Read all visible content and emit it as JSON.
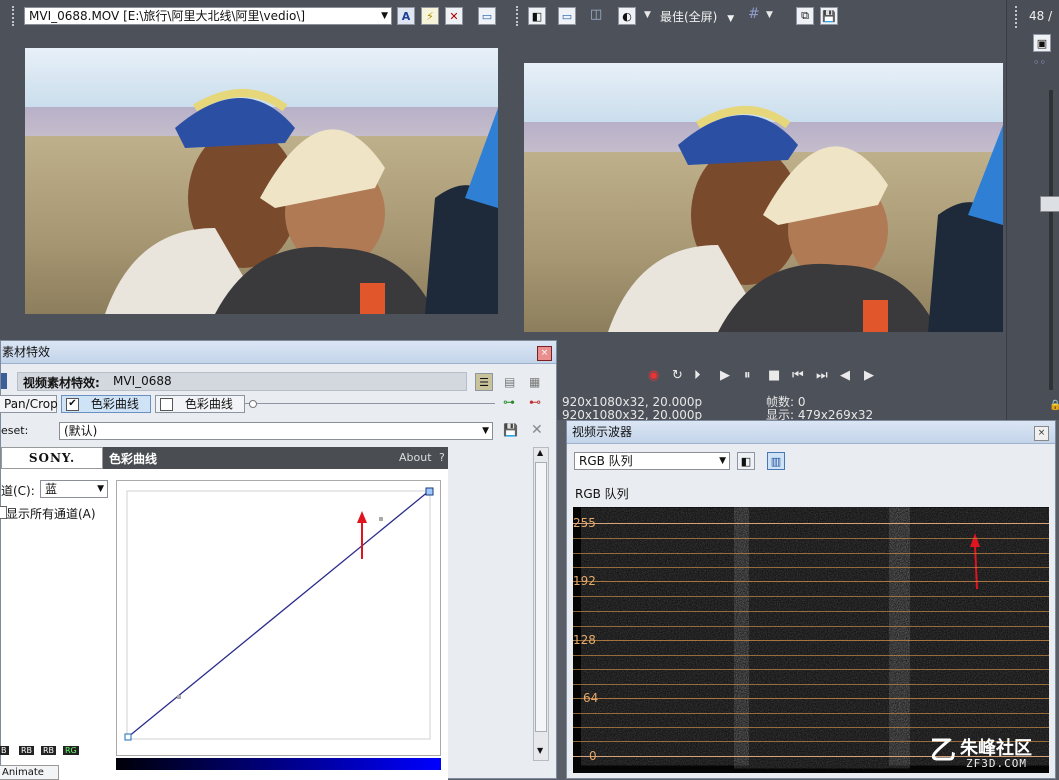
{
  "source_viewer": {
    "clip_dropdown": "MVI_0688.MOV     [E:\\旅行\\阿里大北线\\阿里\\vedio\\]"
  },
  "preview": {
    "quality_label": "最佳(全屏)",
    "info": {
      "project_line": "920x1080x32, 20.000p",
      "preview_line": "920x1080x32, 20.000p",
      "frame_label": "帧数:",
      "frame_value": "0",
      "display_line": "显示: 479x269x32"
    }
  },
  "right_strip": {
    "counter": "48 /"
  },
  "fx_window": {
    "title": "素材特效",
    "header_label": "视频素材特效:",
    "header_clip": "MVI_0688",
    "chain": [
      {
        "label": "Pan/Crop"
      },
      {
        "label": "色彩曲线",
        "checked": true
      },
      {
        "label": "色彩曲线",
        "checked": false
      }
    ],
    "preset_label": "eset:",
    "preset_value": "(默认)",
    "brand": "SONY.",
    "plugin_title": "色彩曲线",
    "about": "About",
    "about_help": "?",
    "channel_label": "道(C):",
    "channel_value": "蓝",
    "show_all_label": "显示所有通道(A)",
    "bottom_tab": "Animate",
    "channel_chips": [
      "B",
      "RB",
      "RB",
      "RG"
    ]
  },
  "scope_window": {
    "title": "视频示波器",
    "mode_value": "RGB 队列",
    "section_label": "RGB 队列",
    "y_ticks": [
      "255",
      "192",
      "128",
      "64",
      "0"
    ],
    "watermark_main": "朱峰社区",
    "watermark_sub": "ZF3D.COM"
  },
  "colors": {
    "accent_red": "#e0141e",
    "curve_line": "#2c2c8c",
    "scope_grid": "#c98a45"
  },
  "icons": {
    "closebox": "×",
    "dropdown": "▼"
  }
}
